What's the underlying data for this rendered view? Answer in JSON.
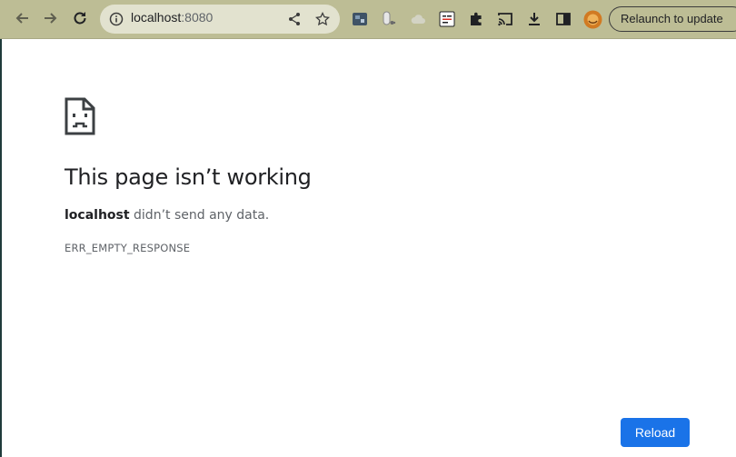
{
  "browser": {
    "url_host": "localhost",
    "url_port": ":8080",
    "relaunch_label": "Relaunch to update"
  },
  "error": {
    "title": "This page isn’t working",
    "host": "localhost",
    "message": " didn’t send any data.",
    "code": "ERR_EMPTY_RESPONSE",
    "reload_label": "Reload"
  },
  "colors": {
    "toolbar": "#bdbd95",
    "accent": "#1a73e8"
  }
}
